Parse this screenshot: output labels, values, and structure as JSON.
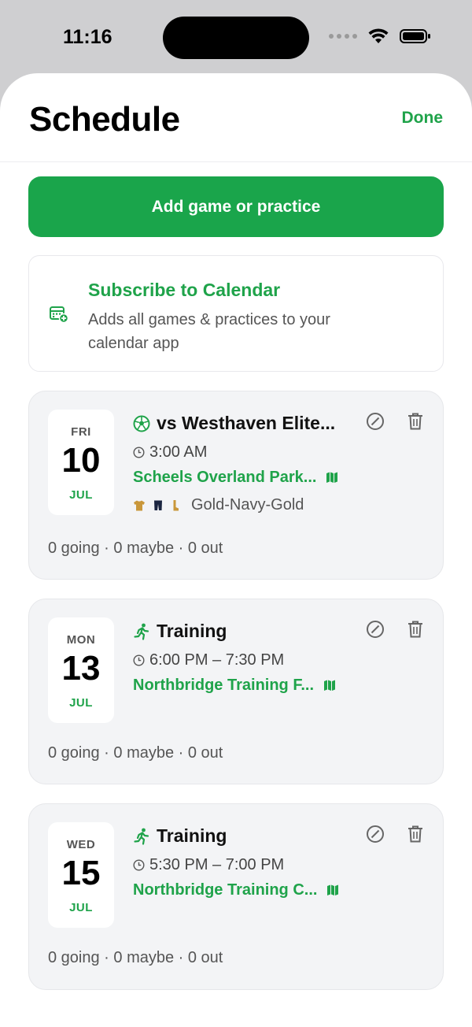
{
  "status_bar": {
    "time": "11:16"
  },
  "header": {
    "title": "Schedule",
    "done_label": "Done"
  },
  "add_button_label": "Add game or practice",
  "subscribe": {
    "title": "Subscribe to Calendar",
    "description": "Adds all games & practices to your calendar app"
  },
  "events": [
    {
      "dow": "FRI",
      "day": "10",
      "month": "JUL",
      "type_icon": "soccer-ball-icon",
      "title": "vs Westhaven Elite...",
      "time": "3:00 AM",
      "location": "Scheels Overland Park...",
      "kit": "Gold-Navy-Gold",
      "counts": "0 going · 0 maybe · 0 out"
    },
    {
      "dow": "MON",
      "day": "13",
      "month": "JUL",
      "type_icon": "running-icon",
      "title": "Training",
      "time": "6:00 PM – 7:30 PM",
      "location": "Northbridge Training F...",
      "counts": "0 going · 0 maybe · 0 out"
    },
    {
      "dow": "WED",
      "day": "15",
      "month": "JUL",
      "type_icon": "running-icon",
      "title": "Training",
      "time": "5:30 PM – 7:00 PM",
      "location": "Northbridge Training C...",
      "counts": "0 going · 0 maybe · 0 out"
    }
  ],
  "colors": {
    "accent": "#1aa54b",
    "card_bg": "#f3f4f6",
    "kit_gold": "#c9973a",
    "kit_navy": "#1b2540"
  }
}
